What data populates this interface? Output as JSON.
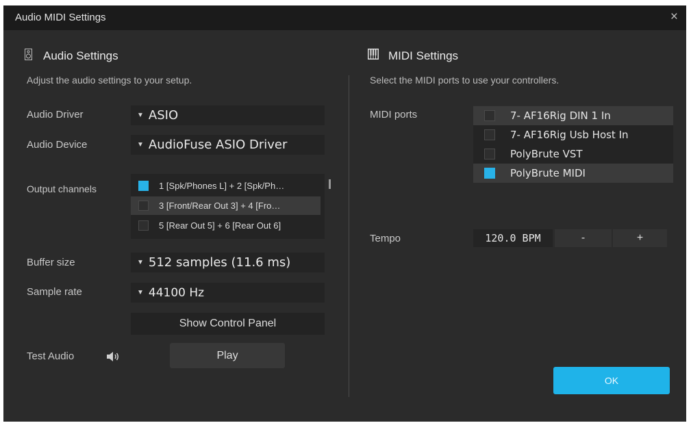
{
  "window": {
    "title": "Audio MIDI Settings",
    "close_label": "×"
  },
  "audio": {
    "title": "Audio Settings",
    "subtitle": "Adjust the audio settings to your setup.",
    "driver_label": "Audio Driver",
    "driver_value": "ASIO",
    "device_label": "Audio Device",
    "device_value": "AudioFuse ASIO Driver",
    "output_label": "Output channels",
    "outputs": [
      {
        "label": "1 [Spk/Phones L] + 2 [Spk/Ph…",
        "checked": true
      },
      {
        "label": "3 [Front/Rear Out 3] + 4 [Fro…",
        "checked": false
      },
      {
        "label": "5 [Rear Out 5] + 6 [Rear Out 6]",
        "checked": false
      }
    ],
    "buffer_label": "Buffer size",
    "buffer_value": "512 samples (11.6 ms)",
    "rate_label": "Sample rate",
    "rate_value": "44100 Hz",
    "control_panel_label": "Show Control Panel",
    "test_label": "Test Audio",
    "play_label": "Play"
  },
  "midi": {
    "title": "MIDI Settings",
    "subtitle": "Select the MIDI ports to use your controllers.",
    "ports_label": "MIDI ports",
    "ports": [
      {
        "label": "7- AF16Rig DIN 1 In",
        "checked": false
      },
      {
        "label": "7- AF16Rig Usb Host In",
        "checked": false
      },
      {
        "label": "PolyBrute VST",
        "checked": false
      },
      {
        "label": "PolyBrute MIDI",
        "checked": true
      }
    ],
    "tempo_label": "Tempo",
    "tempo_value": "120.0 BPM",
    "minus_label": "-",
    "plus_label": "+"
  },
  "ok_label": "OK",
  "colors": {
    "accent": "#1fb3e9",
    "background": "#2b2b2b",
    "titlebar": "#1b1b1b"
  }
}
